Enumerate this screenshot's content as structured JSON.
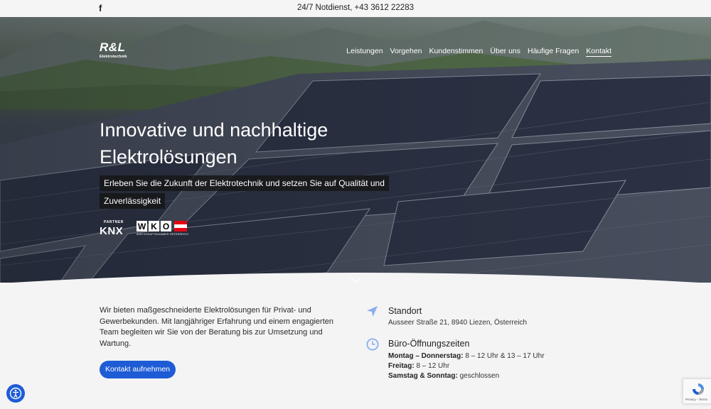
{
  "topbar": {
    "facebook_glyph": "f",
    "notdienst": "24/7 Notdienst, +43 3612 22283"
  },
  "logo": {
    "mark": "R&L",
    "subtitle": "Elektrotechnik"
  },
  "nav": {
    "items": [
      "Leistungen",
      "Vorgehen",
      "Kundenstimmen",
      "Über uns",
      "Häufige Fragen",
      "Kontakt"
    ],
    "active": "Kontakt"
  },
  "hero": {
    "title": "Innovative und nachhaltige Elektrolösungen",
    "subtitle": "Erleben Sie die Zukunft der Elektrotechnik und setzen Sie auf Qualität und Zuverlässigkeit"
  },
  "badges": {
    "knx_partner": "PARTNER",
    "knx": "KNX",
    "wko_letters": [
      "W",
      "K",
      "O"
    ],
    "wko_text": "WIRTSCHAFTSKAMMER ÖSTERREICH"
  },
  "intro": {
    "text": "Wir bieten maßgeschneiderte Elektrolösungen für Privat- und Gewerbekunden. Mit langjähriger Erfahrung und einem engagierten Team begleiten wir Sie von der Beratung bis zur Umsetzung und Wartung.",
    "cta": "Kontakt aufnehmen"
  },
  "location": {
    "heading": "Standort",
    "address": "Ausseer Straße 21, 8940 Liezen, Österreich"
  },
  "hours": {
    "heading": "Büro-Öffnungszeiten",
    "rows": [
      {
        "label": "Montag – Donnerstag:",
        "value": "8 – 12 Uhr & 13 – 17 Uhr"
      },
      {
        "label": "Freitag:",
        "value": "8 – 12 Uhr"
      },
      {
        "label": "Samstag & Sonntag:",
        "value": "geschlossen"
      }
    ]
  },
  "recaptcha": {
    "links": "Privacy - Terms"
  },
  "icons": {
    "facebook": "facebook-icon",
    "location": "navigation-arrow-icon",
    "hours": "clock-icon",
    "accessibility": "accessibility-icon",
    "scroll": "chevron-down-icon"
  },
  "colors": {
    "accent": "#1e5cd6",
    "icon": "#8aaef0",
    "background": "#f4f4f5"
  }
}
